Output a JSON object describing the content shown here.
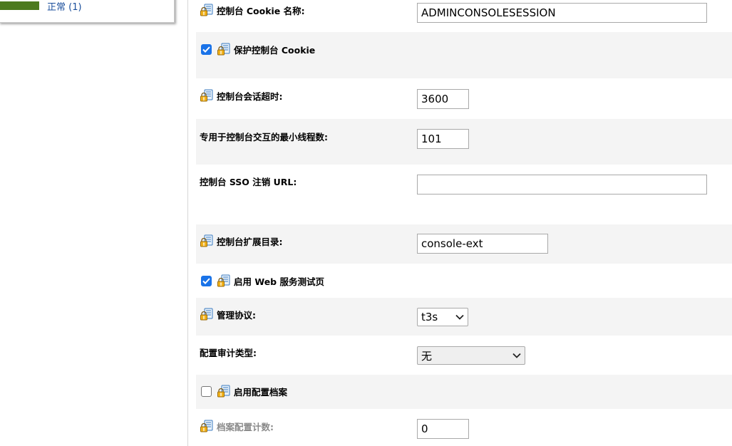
{
  "health": {
    "status_label": "正常 (1)",
    "bar_color": "#4d7a1f"
  },
  "form": {
    "cookie_name": {
      "label": "控制台 Cookie 名称:",
      "value": "ADMINCONSOLESESSION"
    },
    "protect_cookie": {
      "label": "保护控制台 Cookie",
      "checked": true
    },
    "session_timeout": {
      "label": "控制台会话超时:",
      "value": "3600"
    },
    "min_threads": {
      "label": "专用于控制台交互的最小线程数:",
      "value": "101"
    },
    "sso_logout_url": {
      "label": "控制台 SSO 注销 URL:",
      "value": ""
    },
    "extension_dir": {
      "label": "控制台扩展目录:",
      "value": "console-ext"
    },
    "enable_web_test_page": {
      "label": "启用 Web 服务测试页",
      "checked": true
    },
    "admin_protocol": {
      "label": "管理协议:",
      "selected": "t3s"
    },
    "config_audit_type": {
      "label": "配置审计类型:",
      "selected": "无"
    },
    "enable_config_archive": {
      "label": "启用配置档案",
      "checked": false
    },
    "archive_count": {
      "label": "档案配置计数:",
      "value": "0"
    }
  },
  "icons": {
    "config_icon": "settings-lock-icon",
    "checkmark": "checkmark-icon",
    "dropdown": "chevron-down-icon"
  },
  "colors": {
    "accent": "#1a73e8",
    "row_shade": "#f4f4f4",
    "link": "#1b4f9c"
  }
}
